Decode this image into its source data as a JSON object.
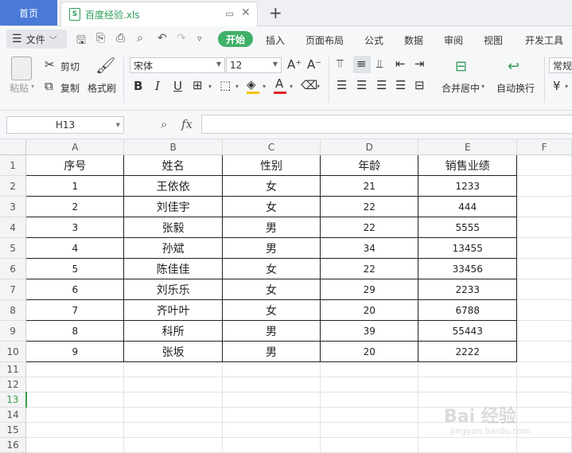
{
  "tabs": {
    "home": "首页",
    "file": "百度经验.xls",
    "new_tab": "+"
  },
  "menu": {
    "file": "文件",
    "start": "开始",
    "items": [
      "插入",
      "页面布局",
      "公式",
      "数据",
      "审阅",
      "视图",
      "开发工具"
    ]
  },
  "ribbon": {
    "paste": "粘贴",
    "cut": "剪切",
    "copy": "复制",
    "format_painter": "格式刷",
    "font_name": "宋体",
    "font_size": "12",
    "merge_center": "合并居中",
    "wrap_text": "自动换行",
    "number_format": "常规"
  },
  "formula_bar": {
    "name_box": "H13",
    "fx": "fx",
    "formula": ""
  },
  "sheet": {
    "columns": [
      "A",
      "B",
      "C",
      "D",
      "E",
      "F"
    ],
    "rows": [
      "1",
      "2",
      "3",
      "4",
      "5",
      "6",
      "7",
      "8",
      "9",
      "10",
      "11",
      "12",
      "13",
      "14",
      "15",
      "16"
    ],
    "active_row": "13",
    "headers": [
      "序号",
      "姓名",
      "性别",
      "年龄",
      "销售业绩"
    ],
    "data": [
      [
        "1",
        "王依依",
        "女",
        "21",
        "1233"
      ],
      [
        "2",
        "刘佳宇",
        "女",
        "22",
        "444"
      ],
      [
        "3",
        "张毅",
        "男",
        "22",
        "5555"
      ],
      [
        "4",
        "孙斌",
        "男",
        "34",
        "13455"
      ],
      [
        "5",
        "陈佳佳",
        "女",
        "22",
        "33456"
      ],
      [
        "6",
        "刘乐乐",
        "女",
        "29",
        "2233"
      ],
      [
        "7",
        "齐叶叶",
        "女",
        "20",
        "6788"
      ],
      [
        "8",
        "科所",
        "男",
        "39",
        "55443"
      ],
      [
        "9",
        "张坂",
        "男",
        "20",
        "2222"
      ]
    ]
  },
  "watermark": {
    "text": "Bai 经验",
    "sub": "jingyan.baidu.com"
  },
  "accent_colors": {
    "start_tab": "#3fb068",
    "home_tab": "#4a79d8",
    "file_name": "#2e9b5b"
  }
}
